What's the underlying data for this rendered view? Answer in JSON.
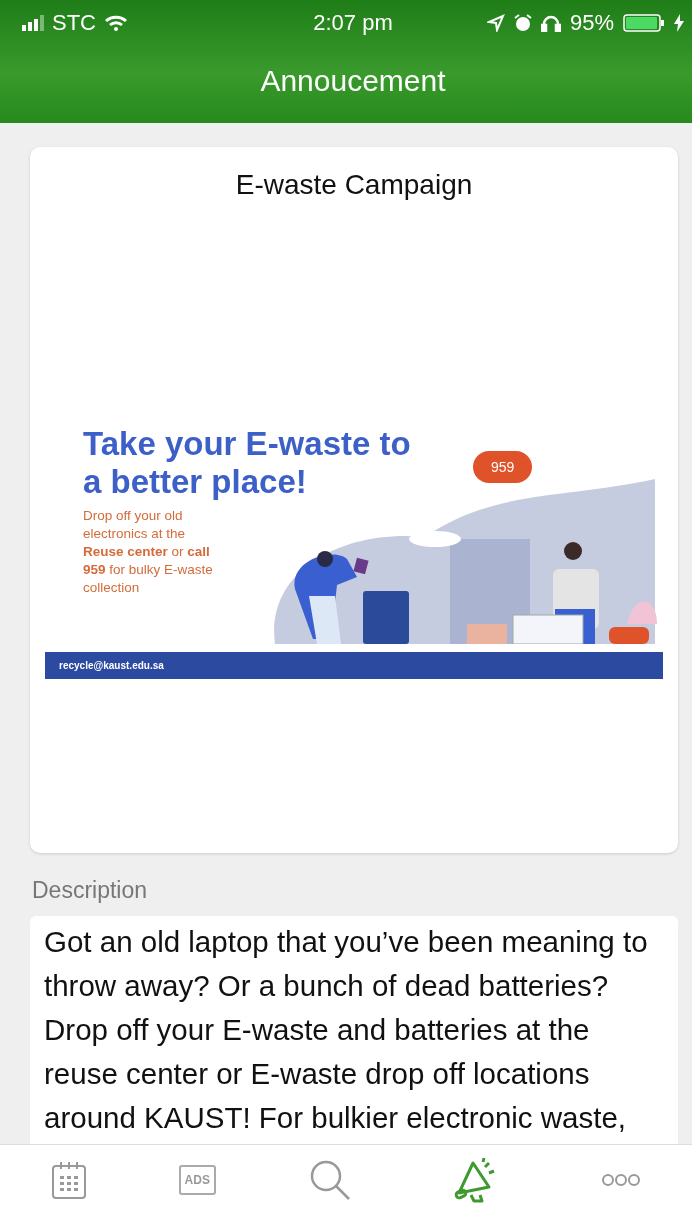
{
  "status_bar": {
    "carrier": "STC",
    "time": "2:07 pm",
    "battery": "95%"
  },
  "header": {
    "title": "Annoucement"
  },
  "card": {
    "title": "E-waste Campaign",
    "banner": {
      "headline": "Take your E-waste to a better place!",
      "body": "Drop off your old electronics at the **Reuse center** or **call 959** for bulky E-waste collection",
      "bubble": "959",
      "email": "recycle@kaust.edu.sa"
    }
  },
  "description": {
    "label": "Description",
    "text": "Got an old laptop that you’ve been meaning to throw away? Or a bunch of dead batteries? Drop off your E-waste and batteries at the reuse center or E-waste drop off locations around KAUST! For bulkier electronic waste,"
  },
  "tabs": [
    {
      "kind": "calendar",
      "selected": false
    },
    {
      "kind": "ads",
      "label": "ADS",
      "selected": false
    },
    {
      "kind": "search",
      "selected": false
    },
    {
      "kind": "announcements",
      "selected": true
    },
    {
      "kind": "more",
      "selected": false
    }
  ]
}
